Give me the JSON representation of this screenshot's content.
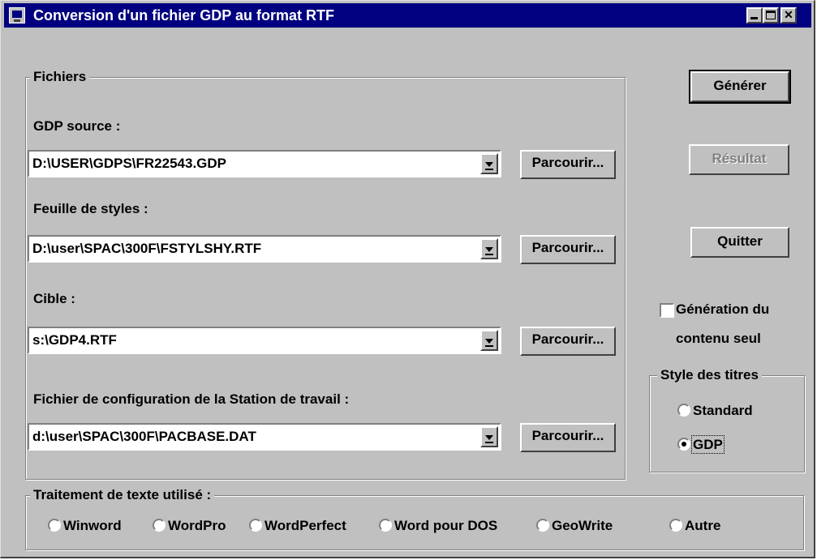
{
  "window": {
    "title": "Conversion d'un fichier GDP au format RTF",
    "icon": "app-window-icon"
  },
  "fichiers": {
    "legend": "Fichiers",
    "gdp_source": {
      "label": "GDP source :",
      "value": "D:\\USER\\GDPS\\FR22543.GDP",
      "browse": "Parcourir..."
    },
    "feuille_styles": {
      "label": "Feuille de styles :",
      "value": "D:\\user\\SPAC\\300F\\FSTYLSHY.RTF",
      "browse": "Parcourir..."
    },
    "cible": {
      "label": "Cible :",
      "value": "s:\\GDP4.RTF",
      "browse": "Parcourir..."
    },
    "config": {
      "label": "Fichier de configuration de la Station de travail :",
      "value": "d:\\user\\SPAC\\300F\\PACBASE.DAT",
      "browse": "Parcourir..."
    }
  },
  "buttons": {
    "generer": "Générer",
    "resultat": "Résultat",
    "quitter": "Quitter"
  },
  "generation_contenu": {
    "line1": "Génération du",
    "line2": "contenu seul",
    "checked": false
  },
  "style_titres": {
    "legend": "Style des titres",
    "options": [
      "Standard",
      "GDP"
    ],
    "selected": "GDP"
  },
  "traitement": {
    "legend": "Traitement de texte utilisé :",
    "options": [
      "Winword",
      "WordPro",
      "WordPerfect",
      "Word pour DOS",
      "GeoWrite",
      "Autre"
    ],
    "selected": null
  }
}
